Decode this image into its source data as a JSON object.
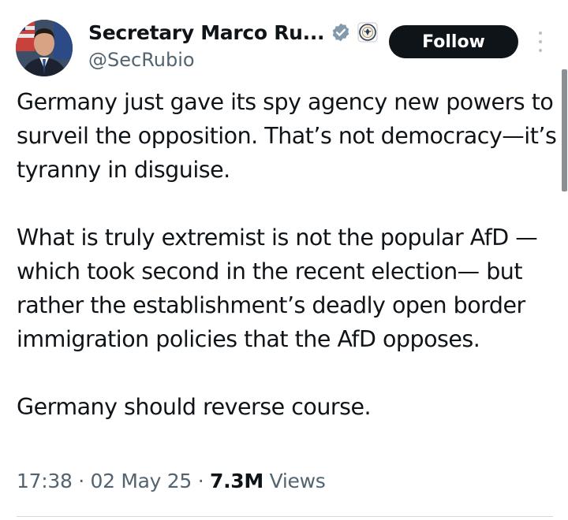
{
  "author": {
    "display_name": "Secretary Marco Ru...",
    "handle": "@SecRubio",
    "avatar_icon": "profile-photo",
    "verified_icon": "government-verified-badge",
    "affiliation_icon": "state-department-seal"
  },
  "actions": {
    "follow_label": "Follow",
    "more_icon": "more-vertical-icon"
  },
  "tweet": {
    "paragraphs": [
      "Germany just gave its spy agency new powers to surveil the opposition.  That’s not democracy—it’s tyranny in disguise.",
      "What is truly extremist is not the popular AfD —which took second in the recent election— but rather the establishment’s deadly open border immigration policies that the AfD opposes.",
      "Germany should reverse course."
    ]
  },
  "meta": {
    "time": "17:38",
    "separator": "·",
    "date": "02 May 25",
    "views_count": "7.3M",
    "views_label": "Views"
  },
  "colors": {
    "text_primary": "#0f1419",
    "text_secondary": "#536471",
    "follow_bg": "#0f1419",
    "verified_badge": "#829aab"
  }
}
